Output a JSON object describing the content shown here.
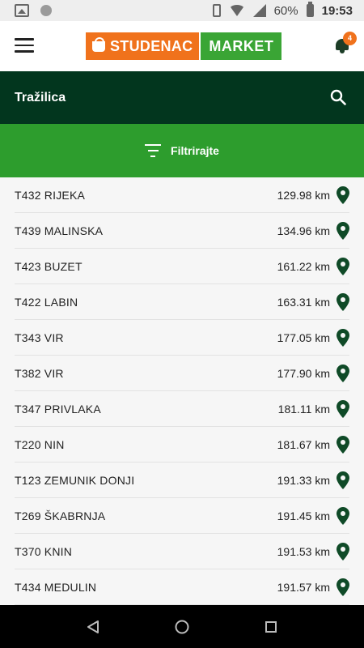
{
  "status_bar": {
    "battery": "60%",
    "time": "19:53"
  },
  "header": {
    "logo_left": "STUDENAC",
    "logo_right": "MARKET",
    "notification_count": "4"
  },
  "search": {
    "title": "Tražilica"
  },
  "filter": {
    "label": "Filtrirajte"
  },
  "stores": [
    {
      "name": "T432 RIJEKA",
      "distance": "129.98 km"
    },
    {
      "name": "T439 MALINSKA",
      "distance": "134.96 km"
    },
    {
      "name": "T423 BUZET",
      "distance": "161.22 km"
    },
    {
      "name": "T422 LABIN",
      "distance": "163.31 km"
    },
    {
      "name": "T343 VIR",
      "distance": "177.05 km"
    },
    {
      "name": "T382 VIR",
      "distance": "177.90 km"
    },
    {
      "name": "T347 PRIVLAKA",
      "distance": "181.11 km"
    },
    {
      "name": "T220 NIN",
      "distance": "181.67 km"
    },
    {
      "name": "T123 ZEMUNIK DONJI",
      "distance": "191.33 km"
    },
    {
      "name": "T269 ŠKABRNJA",
      "distance": "191.45 km"
    },
    {
      "name": "T370 KNIN",
      "distance": "191.53 km"
    },
    {
      "name": "T434 MEDULIN",
      "distance": "191.57 km"
    }
  ],
  "colors": {
    "brand_orange": "#f0721c",
    "brand_green": "#3aa535",
    "dark_green": "#02361e",
    "filter_green": "#2d9d2d"
  }
}
